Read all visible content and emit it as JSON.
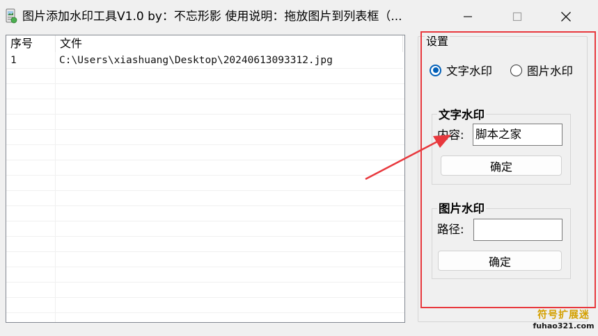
{
  "window": {
    "title": "图片添加水印工具V1.0   by：不忘形影    使用说明：拖放图片到列表框（..."
  },
  "file_list": {
    "columns": [
      "序号",
      "文件"
    ],
    "rows": [
      {
        "index": "1",
        "file": "C:\\Users\\xiashuang\\Desktop\\20240613093312.jpg"
      }
    ]
  },
  "settings": {
    "title": "设置",
    "mode_options": [
      {
        "label": "文字水印",
        "selected": true
      },
      {
        "label": "图片水印",
        "selected": false
      }
    ],
    "text_group": {
      "title": "文字水印",
      "content_label": "内容:",
      "content_value": "脚本之家",
      "confirm_label": "确定"
    },
    "image_group": {
      "title": "图片水印",
      "path_label": "路径:",
      "path_value": "",
      "confirm_label": "确定"
    }
  },
  "watermark": {
    "line1": "符号扩展迷",
    "line2": "fuhao321.com"
  },
  "colors": {
    "accent": "#005fb8",
    "annotation_red": "#e8383d"
  }
}
